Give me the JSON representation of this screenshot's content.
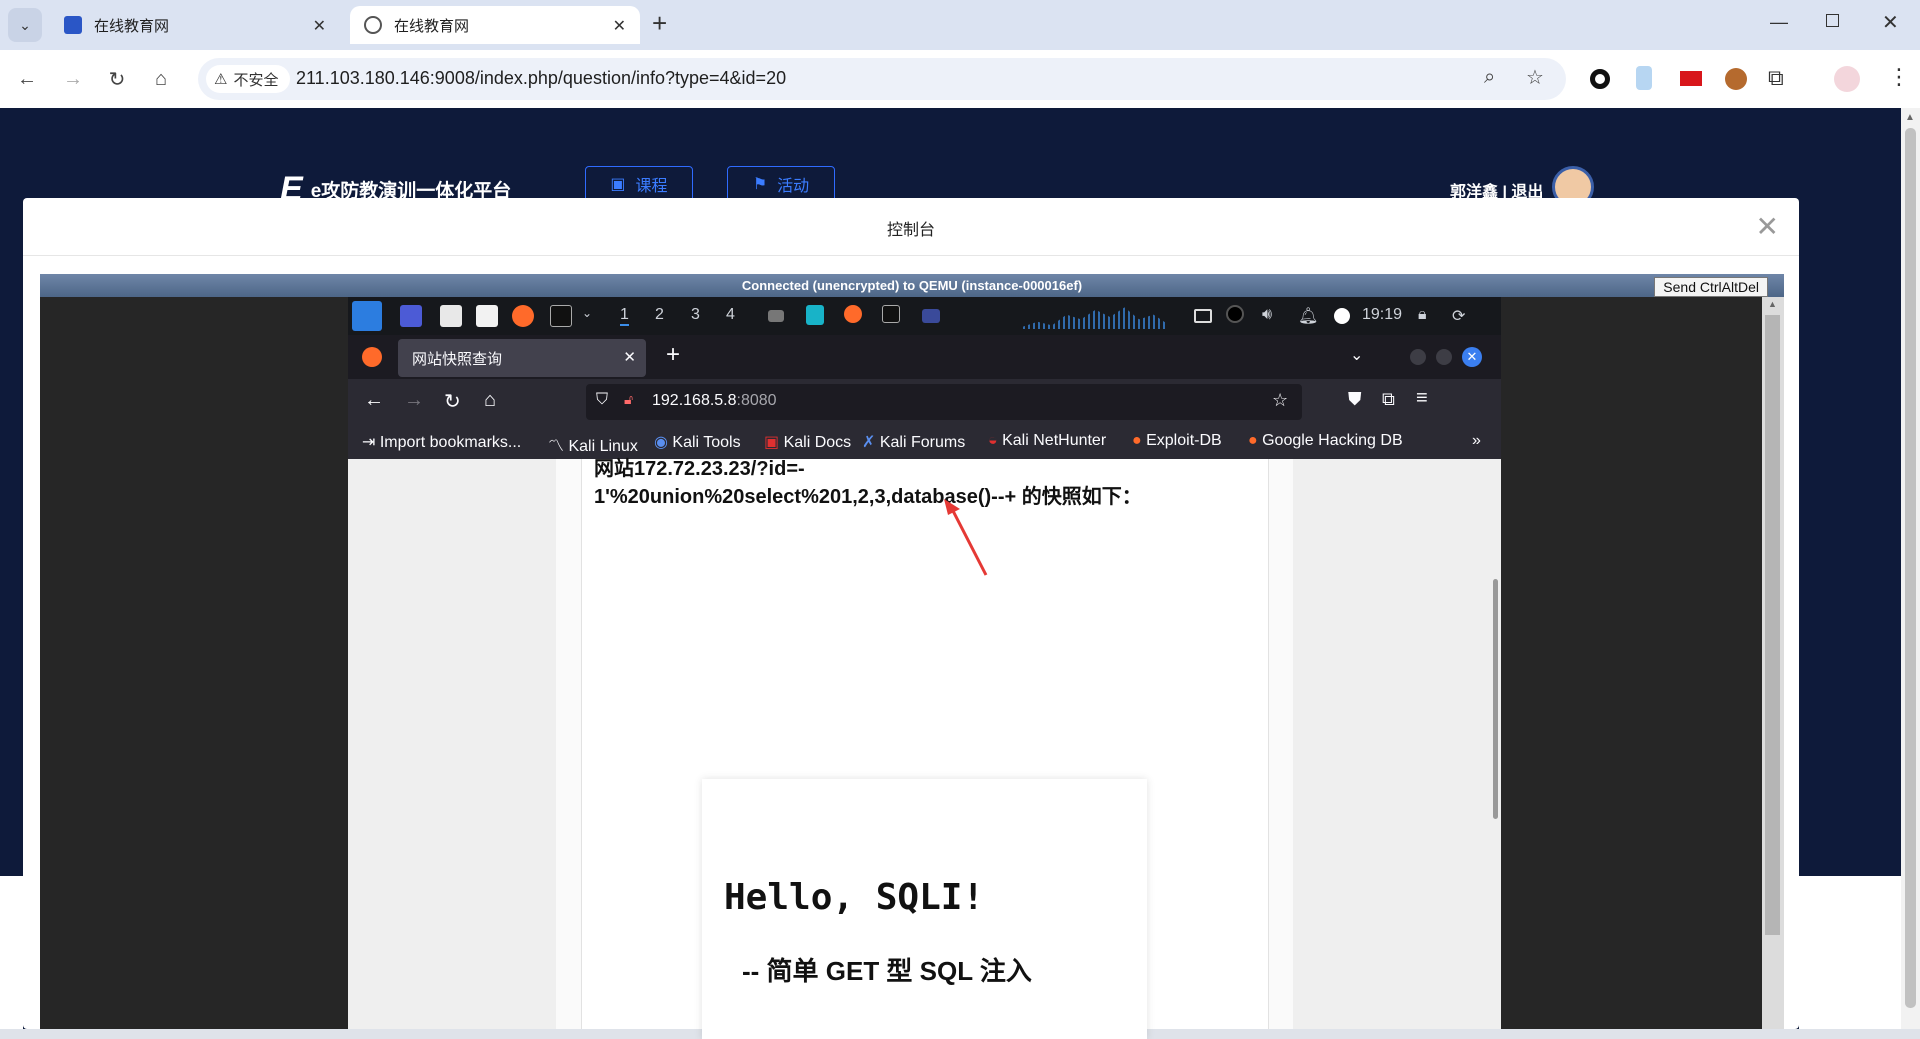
{
  "browser": {
    "tabs": [
      {
        "title": "在线教育网",
        "active": false
      },
      {
        "title": "在线教育网",
        "active": true
      }
    ],
    "new_tab": "+",
    "insecure_label": "不安全",
    "url": "211.103.180.146:9008/index.php/question/info?type=4&id=20"
  },
  "site": {
    "logo_letter": "E",
    "brand": "e攻防教演训一体化平台",
    "nav": [
      {
        "label": "课程"
      },
      {
        "label": "活动"
      }
    ],
    "user": "郭洋鑫 | 退出"
  },
  "modal": {
    "title": "控制台",
    "close": "✕"
  },
  "vnc": {
    "status": "Connected (unencrypted) to QEMU (instance-000016ef)",
    "send_cad": "Send CtrlAltDel"
  },
  "kali": {
    "workspaces": [
      "1",
      "2",
      "3",
      "4"
    ],
    "clock": "19:19",
    "firefox": {
      "tab_title": "网站快照查询",
      "url_host": "192.168.5.8",
      "url_port": ":8080",
      "bookmarks": [
        "Import bookmarks...",
        "Kali Linux",
        "Kali Tools",
        "Kali Docs",
        "Kali Forums",
        "Kali NetHunter",
        "Exploit-DB",
        "Google Hacking DB"
      ]
    },
    "page": {
      "snapshot_line1": "网站172.72.23.23/?id=-",
      "snapshot_line2": "1'%20union%20select%201,2,3,database()--+ 的快照如下：",
      "hello": "Hello, SQLI!",
      "subtitle": "-- 简单 GET 型 SQL 注入"
    }
  },
  "colors": {
    "accent": "#3b7cff",
    "page_bg": "#0e1a3a",
    "annotation": "#e53935"
  }
}
